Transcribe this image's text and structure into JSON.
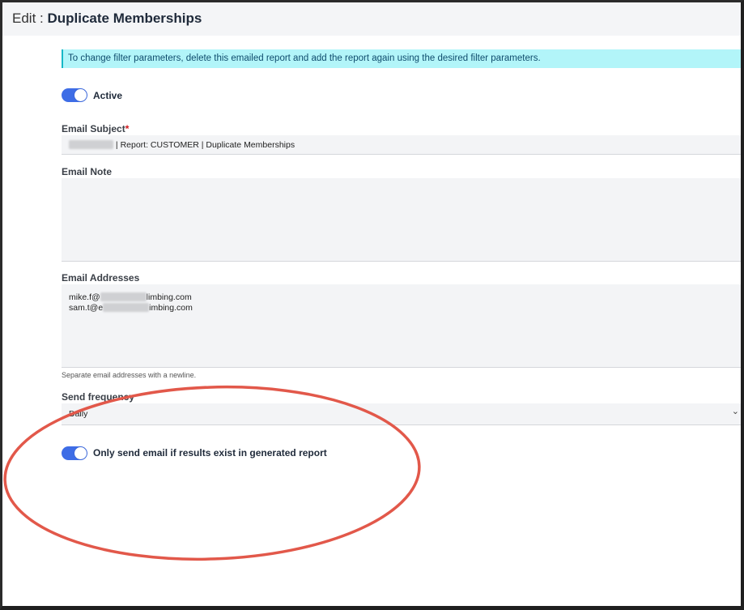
{
  "header": {
    "prefix": "Edit :",
    "title": "Duplicate Memberships"
  },
  "notice": {
    "text": "To change filter parameters, delete this emailed report and add the report again using the desired filter parameters."
  },
  "active_toggle": {
    "label": "Active",
    "checked": true
  },
  "email_subject": {
    "label": "Email Subject",
    "required_mark": "*",
    "value": "| Report: CUSTOMER | Duplicate Memberships"
  },
  "email_note": {
    "label": "Email Note",
    "value": ""
  },
  "email_addresses": {
    "label": "Email Addresses",
    "lines": [
      {
        "prefix": "mike.f@",
        "suffix": "limbing.com"
      },
      {
        "prefix": "sam.t@e",
        "suffix": "imbing.com"
      }
    ],
    "help": "Separate email addresses with a newline."
  },
  "send_frequency": {
    "label": "Send frequency",
    "selected": "Daily"
  },
  "results_toggle": {
    "label": "Only send email if results exist in generated report",
    "checked": true
  },
  "colors": {
    "toggle_on": "#3e6de6",
    "notice_bg": "#b2f5f9",
    "annotation": "#e2584a"
  },
  "icons": {
    "select_chevron": "chevron-down-icon"
  }
}
